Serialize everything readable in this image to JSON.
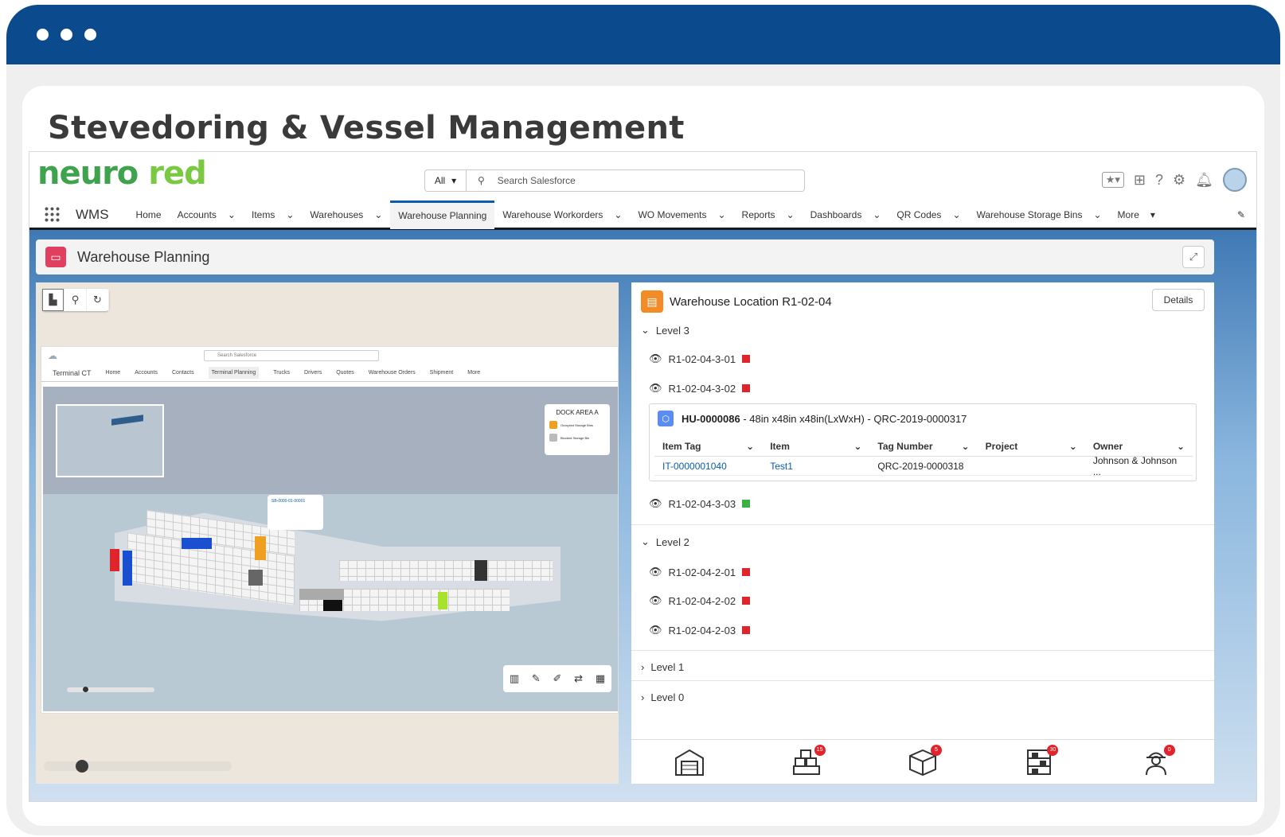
{
  "page": {
    "heading": "Stevedoring & Vessel Management"
  },
  "brand": {
    "logo_part1": "neuro",
    "logo_part2": " red"
  },
  "search": {
    "scope": "All",
    "placeholder": "Search Salesforce"
  },
  "nav": {
    "app_name": "WMS",
    "items": [
      {
        "label": "Home"
      },
      {
        "label": "Accounts"
      },
      {
        "label": "Items"
      },
      {
        "label": "Warehouses"
      },
      {
        "label": "Warehouse Planning"
      },
      {
        "label": "Warehouse Workorders"
      },
      {
        "label": "WO Movements"
      },
      {
        "label": "Reports"
      },
      {
        "label": "Dashboards"
      },
      {
        "label": "QR Codes"
      },
      {
        "label": "Warehouse Storage Bins"
      },
      {
        "label": "More"
      }
    ]
  },
  "workspace": {
    "title": "Warehouse Planning"
  },
  "embedded": {
    "search_placeholder": "Search Salesforce",
    "app_name": "Terminal CT",
    "nav": [
      "Home",
      "Accounts",
      "Contacts",
      "Terminal Planning",
      "Trucks",
      "Drivers",
      "Quotes",
      "Warehouse Orders",
      "Shipment",
      "More"
    ],
    "dock_title": "DOCK AREA A",
    "legend": [
      "Occupied Storage Bins",
      "Blocked Storage Bin"
    ],
    "tooltip_id": "SB-0000-01-00001"
  },
  "location": {
    "title": "Warehouse Location R1-02-04",
    "details_label": "Details",
    "levels": [
      {
        "label": "Level 3"
      },
      {
        "label": "Level 2"
      },
      {
        "label": "Level 1"
      },
      {
        "label": "Level 0"
      }
    ],
    "bins": [
      {
        "id": "R1-02-04-3-01",
        "color": "#e0242b"
      },
      {
        "id": "R1-02-04-3-02",
        "color": "#e0242b"
      },
      {
        "id": "R1-02-04-3-03",
        "color": "#3cb043"
      },
      {
        "id": "R1-02-04-2-01",
        "color": "#e0242b"
      },
      {
        "id": "R1-02-04-2-02",
        "color": "#e0242b"
      },
      {
        "id": "R1-02-04-2-03",
        "color": "#e0242b"
      }
    ],
    "handling_unit": {
      "id": "HU-0000086",
      "desc": " - 48in x48in x48in(LxWxH) - QRC-2019-0000317",
      "columns": [
        "Item Tag",
        "Item",
        "Tag Number",
        "Project",
        "Owner"
      ],
      "row": [
        "IT-0000001040",
        "Test1",
        "QRC-2019-0000318",
        "",
        "Johnson & Johnson ..."
      ]
    }
  },
  "bottom_bar": [
    {
      "icon": "warehouse-icon",
      "count": ""
    },
    {
      "icon": "boxes-icon",
      "count": "15"
    },
    {
      "icon": "package-icon",
      "count": "5"
    },
    {
      "icon": "shelves-icon",
      "count": "30"
    },
    {
      "icon": "worker-icon",
      "count": "0"
    }
  ]
}
